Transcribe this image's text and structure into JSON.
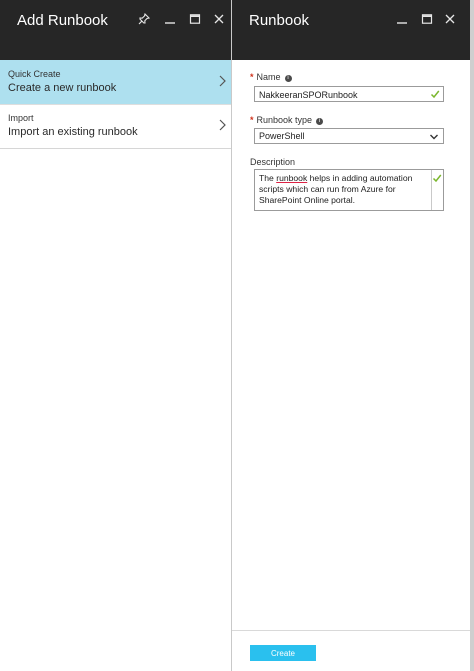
{
  "colors": {
    "header_bg": "#262626",
    "selected_item_bg": "#aee0ef",
    "create_button_bg": "#2ac0ee",
    "required_star": "#d0321c",
    "valid_check": "#7bb72d"
  },
  "left_blade": {
    "title": "Add Runbook",
    "header_icons": [
      "pin-icon",
      "minimize-icon",
      "maximize-icon",
      "close-icon"
    ],
    "items": [
      {
        "kicker": "Quick Create",
        "label": "Create a new runbook",
        "selected": true
      },
      {
        "kicker": "Import",
        "label": "Import an existing runbook",
        "selected": false
      }
    ]
  },
  "right_blade": {
    "title": "Runbook",
    "header_icons": [
      "minimize-icon",
      "maximize-icon",
      "close-icon"
    ],
    "form": {
      "name": {
        "label": "Name",
        "required": true,
        "value": "NakkeeranSPORunbook"
      },
      "runbook_type": {
        "label": "Runbook type",
        "required": true,
        "selected": "PowerShell"
      },
      "description": {
        "label": "Description",
        "text_before": "The ",
        "text_underlined": "runbook",
        "text_after": " helps in adding automation scripts which can run from Azure for SharePoint Online portal."
      }
    },
    "create_label": "Create"
  }
}
